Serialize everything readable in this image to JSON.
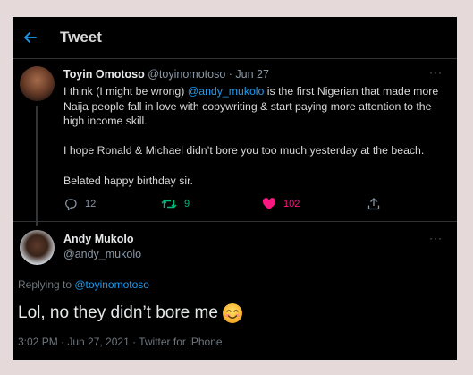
{
  "header": {
    "back_icon": "arrow-left-icon",
    "title": "Tweet"
  },
  "tweet": {
    "author_name": "Toyin Omotoso",
    "author_handle": "@toyinomotoso",
    "separator": " · ",
    "date": "Jun 27",
    "text_part1": "I think (I might be wrong) ",
    "mention": "@andy_mukolo",
    "text_part2": " is the first Nigerian that made more Naija people fall in love with copywriting & start paying more attention to the high income skill.",
    "paragraph2": "I hope Ronald & Michael didn’t bore you too much yesterday at the beach.",
    "paragraph3": "Belated happy birthday sir.",
    "reply_count": "12",
    "retweet_count": "9",
    "like_count": "102",
    "colors": {
      "retweet": "#00ba7c",
      "like": "#f91880",
      "muted": "#8b98a5"
    }
  },
  "reply": {
    "author_name": "Andy Mukolo",
    "author_handle": "@andy_mukolo",
    "replying_to_label": "Replying to ",
    "replying_to_handle": "@toyinomotoso",
    "text": "Lol, no they didn’t bore me",
    "emoji": "smiling-face-with-smiling-eyes",
    "timestamp": "3:02 PM · Jun 27, 2021 · Twitter for iPhone"
  },
  "more_glyph": "···"
}
